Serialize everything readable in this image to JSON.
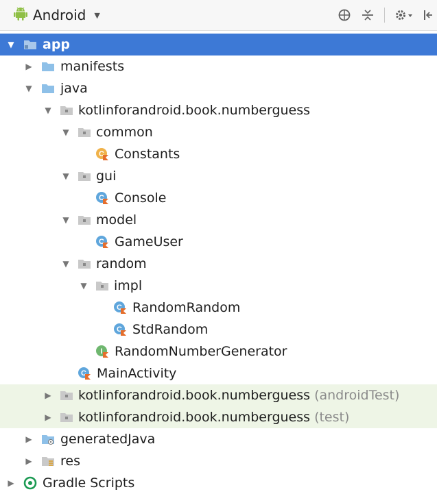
{
  "toolbar": {
    "view_name": "Android",
    "icons": [
      "globe-icon",
      "collapse-all-icon",
      "settings-icon",
      "hide-panel-icon"
    ]
  },
  "tree": {
    "rows": [
      {
        "name": "tree-row-app",
        "label": "app",
        "suffix": "",
        "expanded": true,
        "icon": "module-folder-icon",
        "selected": true
      },
      {
        "name": "tree-row-manifests",
        "label": "manifests",
        "suffix": "",
        "expanded": false,
        "icon": "folder-icon"
      },
      {
        "name": "tree-row-java",
        "label": "java",
        "suffix": "",
        "expanded": true,
        "icon": "folder-icon"
      },
      {
        "name": "tree-row-package-main",
        "label": "kotlinforandroid.book.numberguess",
        "suffix": "",
        "expanded": true,
        "icon": "package-icon"
      },
      {
        "name": "tree-row-common",
        "label": "common",
        "suffix": "",
        "expanded": true,
        "icon": "package-icon"
      },
      {
        "name": "tree-row-constants",
        "label": "Constants",
        "suffix": "",
        "icon": "kotlin-object-icon"
      },
      {
        "name": "tree-row-gui",
        "label": "gui",
        "suffix": "",
        "expanded": true,
        "icon": "package-icon"
      },
      {
        "name": "tree-row-console",
        "label": "Console",
        "suffix": "",
        "icon": "kotlin-class-icon"
      },
      {
        "name": "tree-row-model",
        "label": "model",
        "suffix": "",
        "expanded": true,
        "icon": "package-icon"
      },
      {
        "name": "tree-row-gameuser",
        "label": "GameUser",
        "suffix": "",
        "icon": "kotlin-class-icon"
      },
      {
        "name": "tree-row-random",
        "label": "random",
        "suffix": "",
        "expanded": true,
        "icon": "package-icon"
      },
      {
        "name": "tree-row-impl",
        "label": "impl",
        "suffix": "",
        "expanded": true,
        "icon": "package-icon"
      },
      {
        "name": "tree-row-randomrandom",
        "label": "RandomRandom",
        "suffix": "",
        "icon": "kotlin-class-icon"
      },
      {
        "name": "tree-row-stdrandom",
        "label": "StdRandom",
        "suffix": "",
        "icon": "kotlin-class-icon"
      },
      {
        "name": "tree-row-randomnumbergenerator",
        "label": "RandomNumberGenerator",
        "suffix": "",
        "icon": "kotlin-interface-icon"
      },
      {
        "name": "tree-row-mainactivity",
        "label": "MainActivity",
        "suffix": "",
        "icon": "kotlin-class-icon"
      },
      {
        "name": "tree-row-package-androidtest",
        "label": "kotlinforandroid.book.numberguess",
        "suffix": "(androidTest)",
        "expanded": false,
        "icon": "package-icon"
      },
      {
        "name": "tree-row-package-test",
        "label": "kotlinforandroid.book.numberguess",
        "suffix": "(test)",
        "expanded": false,
        "icon": "package-icon"
      },
      {
        "name": "tree-row-generatedjava",
        "label": "generatedJava",
        "suffix": "",
        "expanded": false,
        "icon": "generated-folder-icon"
      },
      {
        "name": "tree-row-res",
        "label": "res",
        "suffix": "",
        "expanded": false,
        "icon": "resources-folder-icon"
      },
      {
        "name": "tree-row-gradle-scripts",
        "label": "Gradle Scripts",
        "suffix": "",
        "expanded": false,
        "icon": "gradle-icon"
      }
    ]
  },
  "colors": {
    "selection": "#3d79d6",
    "test_row_background": "#eef5e6",
    "folder": "#8ec0e8",
    "kotlin_class": "#5fa6dc",
    "kotlin_object": "#f0b24a",
    "kotlin_interface": "#6fb76f",
    "kotlin_mark": "#e56e2c"
  }
}
